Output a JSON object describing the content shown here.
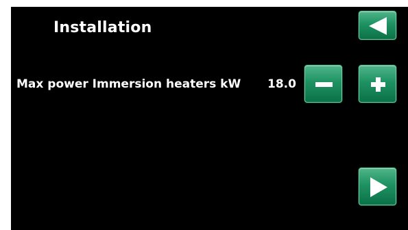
{
  "header": {
    "title": "Installation"
  },
  "parameter": {
    "label": "Max power Immersion heaters kW",
    "value": "18.0"
  },
  "buttons": {
    "back_icon": "triangle-left-icon",
    "decrease_icon": "minus-icon",
    "increase_icon": "plus-icon",
    "next_icon": "triangle-right-icon"
  },
  "colors": {
    "screen_background": "#000000",
    "button_green": "#1e9262",
    "text": "#ffffff"
  }
}
